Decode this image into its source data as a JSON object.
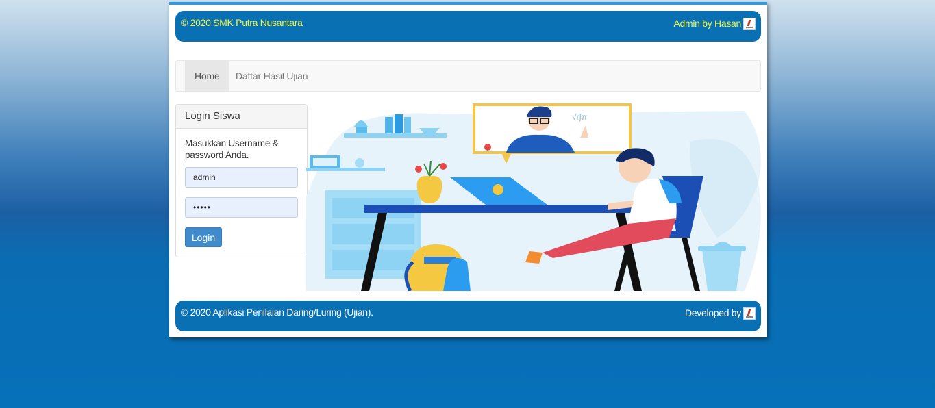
{
  "header": {
    "left_text": "© 2020 SMK Putra Nusantara",
    "right_text": "Admin by Hasan",
    "text_color": "#f2f53a",
    "bg_color": "#0a70b4"
  },
  "nav": {
    "items": [
      {
        "label": "Home"
      },
      {
        "label": "Daftar Hasil Ujian"
      }
    ]
  },
  "login": {
    "title": "Login Siswa",
    "instruction": "Masukkan Username & password Anda.",
    "username_value": "admin",
    "password_value": "•••••",
    "button_label": "Login",
    "button_color": "#428bca"
  },
  "illustration": {
    "icon": "student-online-learning-illustration"
  },
  "footer": {
    "left_text": "© 2020 Aplikasi Penilaian Daring/Luring (Ujian).",
    "right_text": "Developed by"
  }
}
